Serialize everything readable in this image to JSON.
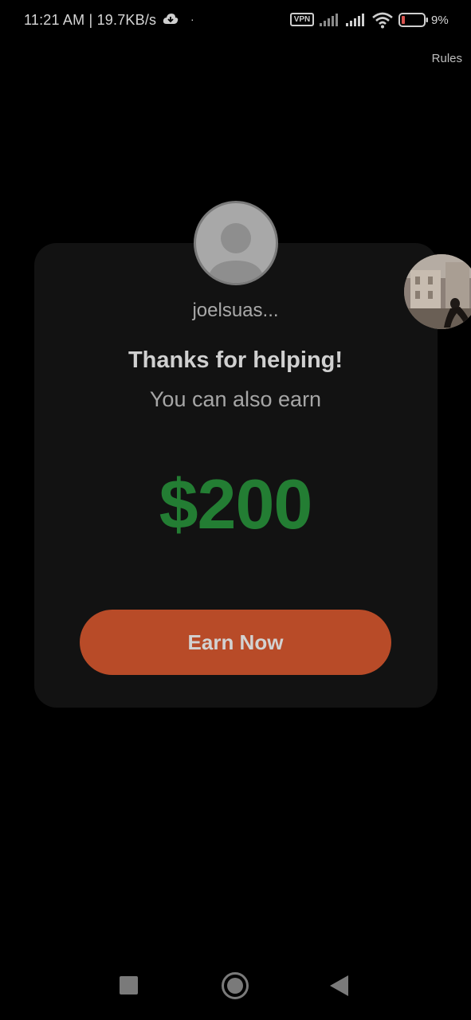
{
  "status_bar": {
    "time_and_speed": "11:21 AM | 19.7KB/s",
    "dot": "·",
    "vpn": "VPN",
    "battery_level": "9%",
    "icons": [
      "cloud-icon",
      "signal-icon",
      "signal-icon",
      "wifi-icon",
      "battery-icon"
    ]
  },
  "header": {
    "rules_label": "Rules"
  },
  "card": {
    "avatar_icon": "default-avatar-icon",
    "username": "joelsuas...",
    "title": "Thanks for helping!",
    "subtitle": "You can also earn",
    "amount": "$200",
    "button_label": "Earn Now"
  },
  "nav_bar": {
    "icons": [
      "recents-icon",
      "home-icon",
      "back-icon"
    ]
  },
  "colors": {
    "background": "#000000",
    "card": "#121212",
    "amount": "#237d33",
    "button": "#b84b28"
  }
}
